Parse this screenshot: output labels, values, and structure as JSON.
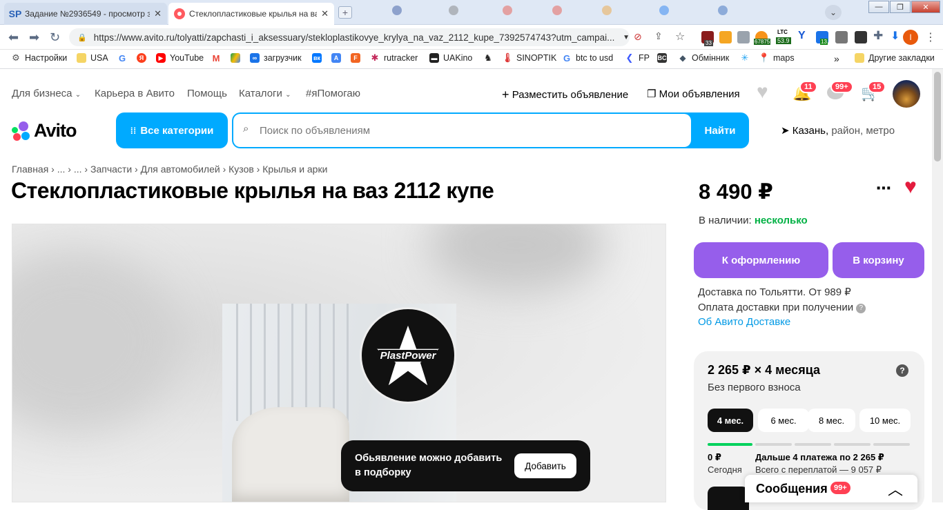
{
  "browser": {
    "tabs": [
      {
        "title": "Задание №2936549 - просмотр за",
        "favicon": "SP"
      },
      {
        "title": "Стеклопластиковые крылья на ва",
        "favicon": "avito"
      }
    ],
    "url": "https://www.avito.ru/tolyatti/zapchasti_i_aksessuary/stekloplastikovye_krylya_na_vaz_2112_kupe_7392574743?utm_campai...",
    "ext_badges": {
      "a": "33",
      "ltc_top": "LTC",
      "ltc_val": "53.9",
      "val2": "67875",
      "b": "13"
    },
    "profile_letter": "I",
    "bookmarks": [
      "Настройки",
      "USA",
      "YouTube",
      "загрузчик",
      "rutracker",
      "UAKino",
      "SINOPTIK",
      "btc to usd",
      "FP",
      "Обмінник",
      "maps"
    ],
    "bookmarks_more": "»",
    "other_bookmarks": "Другие закладки"
  },
  "header": {
    "nav": [
      "Для бизнеса",
      "Карьера в Авито",
      "Помощь",
      "Каталоги",
      "#яПомогаю"
    ],
    "post_ad": "Разместить объявление",
    "my_ads": "Мои объявления",
    "badges": {
      "notifications": "11",
      "messages": "99+",
      "cart": "15"
    },
    "logo_text": "Avito",
    "all_categories": "Все категории",
    "search_placeholder": "Поиск по объявлениям",
    "find": "Найти",
    "location_city": "Казань,",
    "location_rest": " район, метро"
  },
  "breadcrumbs": [
    "Главная",
    "...",
    "...",
    "Запчасти",
    "Для автомобилей",
    "Кузов",
    "Крылья и арки"
  ],
  "listing": {
    "title": "Стеклопластиковые крылья на ваз 2112 купе",
    "photo_logo_text": "PlastPower",
    "price": "8 490 ₽",
    "stock_label": "В наличии: ",
    "stock_value": "несколько",
    "checkout": "К оформлению",
    "to_cart": "В корзину",
    "delivery": "Доставка по Тольятти. От 989 ₽",
    "delivery_payment": "Оплата доставки при получении",
    "about_delivery": "Об Авито Доставке"
  },
  "installment": {
    "amount": "2 265 ₽ × 4 месяца",
    "subtitle": "Без первого взноса",
    "terms": [
      "4 мес.",
      "6 мес.",
      "8 мес.",
      "10 мес."
    ],
    "selected_term": "4 мес.",
    "today_amount": "0 ₽",
    "today_label": "Сегодня",
    "next_payments": "Дальше 4 платежа по 2 265 ₽",
    "total": "Всего с переплатой — 9 057 ₽"
  },
  "toast": {
    "text": "Обьявление можно добавить в подборку",
    "button": "Добавить"
  },
  "messages_widget": {
    "label": "Сообщения",
    "badge": "99+"
  },
  "colors": {
    "accent_blue": "#00aaff",
    "purple": "#965eeb",
    "green": "#02b144",
    "red": "#ff4053"
  }
}
